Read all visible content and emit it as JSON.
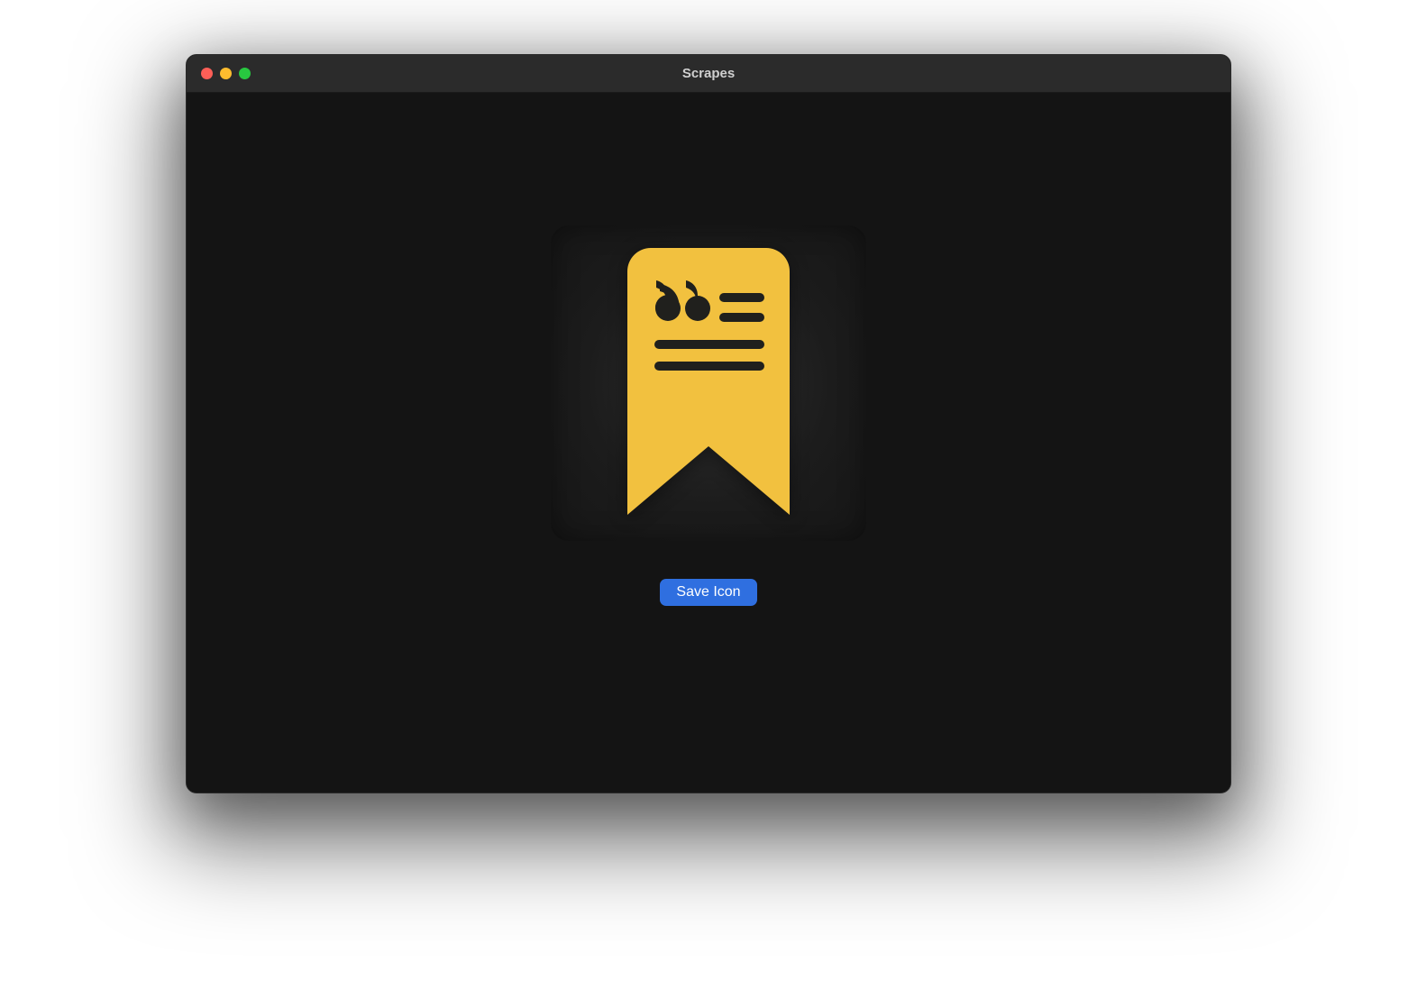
{
  "window": {
    "title": "Scrapes"
  },
  "main": {
    "save_button_label": "Save Icon",
    "icon_name": "bookmark-quote-icon",
    "colors": {
      "bookmark_fill": "#f2c13f",
      "bookmark_detail": "#20201d",
      "button_bg": "#2f6fe0",
      "tile_bg_center": "#2f2f2f",
      "tile_bg_edge": "#161616"
    }
  }
}
